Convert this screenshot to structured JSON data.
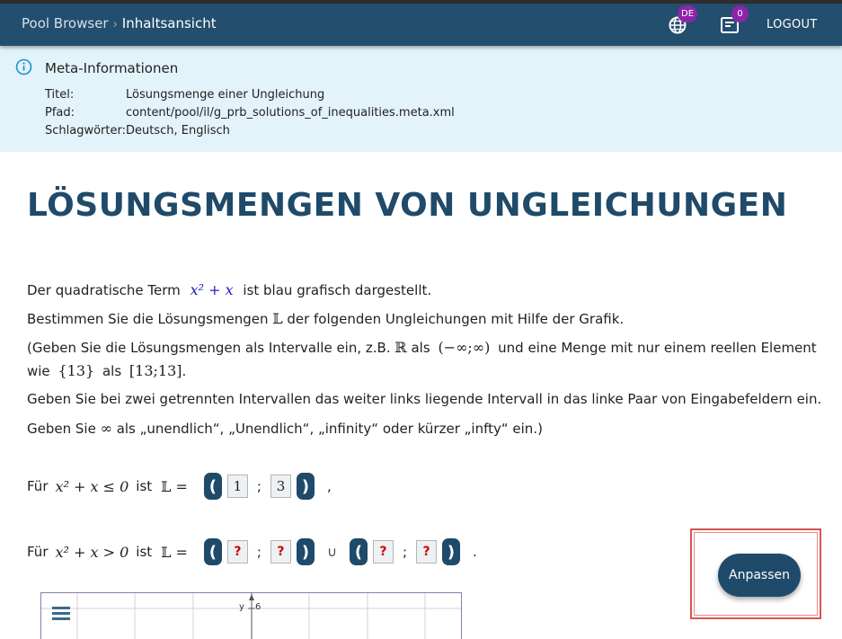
{
  "header": {
    "breadcrumb_root": "Pool Browser",
    "breadcrumb_separator": "›",
    "breadcrumb_current": "Inhaltsansicht",
    "language_badge": "DE",
    "notifications_badge": "0",
    "logout_label": "LOGOUT",
    "background": "#234e6e",
    "badge_color": "#8e24aa"
  },
  "meta": {
    "title": "Meta-Informationen",
    "rows": [
      {
        "key": "Titel:",
        "value": "Lösungsmenge einer Ungleichung"
      },
      {
        "key": "Pfad:",
        "value": "content/pool/il/g_prb_solutions_of_inequalities.meta.xml"
      },
      {
        "key": "Schlagwörter:",
        "value": "Deutsch, Englisch"
      }
    ],
    "background": "#e2f3f9"
  },
  "content": {
    "heading": "LÖSUNGSMENGEN VON UNGLEICHUNGEN",
    "p1_pre": "Der quadratische Term",
    "p1_post": "ist blau grafisch dargestellt.",
    "p2_pre": "Bestimmen Sie die Lösungsmengen",
    "p2_post": "der folgenden Ungleichungen mit Hilfe der Grafik.",
    "p3_a": "(Geben Sie die Lösungsmengen als Intervalle ein, z.B.",
    "p3_b": "als",
    "p3_c": "und eine Menge mit nur einem reellen Element",
    "p4_a": "wie",
    "p4_b": "als",
    "p4_c": ".",
    "p5": "Geben Sie bei zwei getrennten Intervallen das weiter links liegende Intervall in das linke Paar von Eingabefeldern ein.",
    "p6_pre": "Geben Sie",
    "p6_post": "als „unendlich“, „Unendlich“, „infinity“ oder kürzer „infty“ ein.)",
    "math_term": "x² + x",
    "math_L": "𝕃",
    "math_R": "ℝ",
    "math_interval": "(−∞;∞)",
    "math_set13": "{13}",
    "math_int13": "[13;13]",
    "math_inf": "∞",
    "term_color": "#2323b8"
  },
  "eq1": {
    "prefix": "Für",
    "inequality": "x² + x ≤ 0",
    "ist": "ist",
    "lhs": "𝕃 =",
    "open": "(",
    "close": ")",
    "a": "1",
    "sep": ";",
    "b": "3",
    "suffix": ","
  },
  "eq2": {
    "prefix": "Für",
    "inequality": "x² + x > 0",
    "ist": "ist",
    "lhs": "𝕃 =",
    "open": "(",
    "close": ")",
    "a1": "?",
    "sep": ";",
    "b1": "?",
    "union": "∪",
    "a2": "?",
    "b2": "?",
    "suffix": "."
  },
  "adjust_button": {
    "label": "Anpassen"
  },
  "graph": {
    "menu_icon": "hamburger-icon",
    "y_axis_label": "y",
    "y_tick": "6"
  },
  "icons": {
    "language": "globe-icon",
    "notifications": "inbox-icon",
    "info": "info-circle-icon"
  }
}
